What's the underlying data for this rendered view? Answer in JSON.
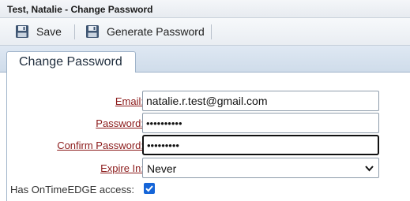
{
  "window": {
    "title": "Test, Natalie - Change Password"
  },
  "toolbar": {
    "save_label": "Save",
    "generate_label": "Generate Password",
    "save_icon": "floppy-disk-icon",
    "generate_icon": "floppy-disk-icon"
  },
  "tabs": [
    {
      "label": "Change Password",
      "active": true
    }
  ],
  "form": {
    "email": {
      "label": "Email:",
      "value": "natalie.r.test@gmail.com"
    },
    "password": {
      "label": "Password:",
      "value": "••••••••••"
    },
    "confirm_password": {
      "label": "Confirm Password:",
      "value": "•••••••••"
    },
    "expire_in": {
      "label": "Expire In:",
      "selected": "Never"
    },
    "ontimeedge_access": {
      "label": "Has OnTimeEDGE access:",
      "checked": true
    }
  }
}
